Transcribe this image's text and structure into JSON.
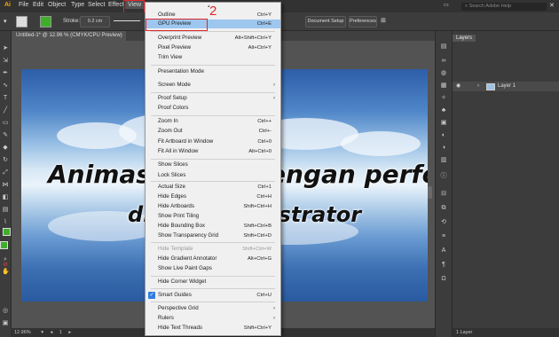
{
  "menubar": {
    "items": [
      "File",
      "Edit",
      "Object",
      "Type",
      "Select",
      "Effect",
      "View"
    ]
  },
  "search": {
    "placeholder": "Search Adobe Help"
  },
  "control_bar": {
    "stroke_label": "Stroke:",
    "stroke_value": "0.2 cm",
    "document_setup": "Document Setup",
    "preferences": "Preferences"
  },
  "document_tab": {
    "title": "Untitled-1* @ 12.96 % (CMYK/CPU Preview)"
  },
  "canvas": {
    "headline_line1": "Animasi zoom dengan performa GPU",
    "headline_line2": "di Adobe Illustrator"
  },
  "status_bar": {
    "zoom": "12.96%",
    "page": "1"
  },
  "layers_panel": {
    "tab_label": "Layers",
    "layer_name": "Layer 1",
    "footer_count": "1 Layer"
  },
  "annotation": {
    "step_number": "2"
  },
  "view_menu": {
    "items": [
      {
        "label": "Outline",
        "shortcut": "Ctrl+Y"
      },
      {
        "label": "GPU Preview",
        "shortcut": "Ctrl+E"
      },
      {
        "label": "Overprint Preview",
        "shortcut": "Alt+Shift+Ctrl+Y"
      },
      {
        "label": "Pixel Preview",
        "shortcut": "Alt+Ctrl+Y"
      },
      {
        "label": "Trim View",
        "shortcut": ""
      },
      {
        "label": "Presentation Mode",
        "shortcut": ""
      },
      {
        "label": "Screen Mode",
        "shortcut": ""
      },
      {
        "label": "Proof Setup",
        "shortcut": ""
      },
      {
        "label": "Proof Colors",
        "shortcut": ""
      },
      {
        "label": "Zoom In",
        "shortcut": "Ctrl++"
      },
      {
        "label": "Zoom Out",
        "shortcut": "Ctrl+-"
      },
      {
        "label": "Fit Artboard in Window",
        "shortcut": "Ctrl+0"
      },
      {
        "label": "Fit All in Window",
        "shortcut": "Alt+Ctrl+0"
      },
      {
        "label": "Show Slices",
        "shortcut": ""
      },
      {
        "label": "Lock Slices",
        "shortcut": ""
      },
      {
        "label": "Actual Size",
        "shortcut": "Ctrl+1"
      },
      {
        "label": "Hide Edges",
        "shortcut": "Ctrl+H"
      },
      {
        "label": "Hide Artboards",
        "shortcut": "Shift+Ctrl+H"
      },
      {
        "label": "Show Print Tiling",
        "shortcut": ""
      },
      {
        "label": "Hide Bounding Box",
        "shortcut": "Shift+Ctrl+B"
      },
      {
        "label": "Show Transparency Grid",
        "shortcut": "Shift+Ctrl+D"
      },
      {
        "label": "Hide Template",
        "shortcut": "Shift+Ctrl+W"
      },
      {
        "label": "Hide Gradient Annotator",
        "shortcut": "Alt+Ctrl+G"
      },
      {
        "label": "Show Live Paint Gaps",
        "shortcut": ""
      },
      {
        "label": "Hide Corner Widget",
        "shortcut": ""
      },
      {
        "label": "Smart Guides",
        "shortcut": "Ctrl+U"
      },
      {
        "label": "Perspective Grid",
        "shortcut": ""
      },
      {
        "label": "Rulers",
        "shortcut": ""
      },
      {
        "label": "Hide Text Threads",
        "shortcut": "Shift+Ctrl+Y"
      }
    ]
  },
  "colors": {
    "highlight_box": "#e0262b",
    "menu_hover": "#9dc7ef",
    "check": "#2f7de1",
    "fill_swatch": "#3fae2a"
  }
}
